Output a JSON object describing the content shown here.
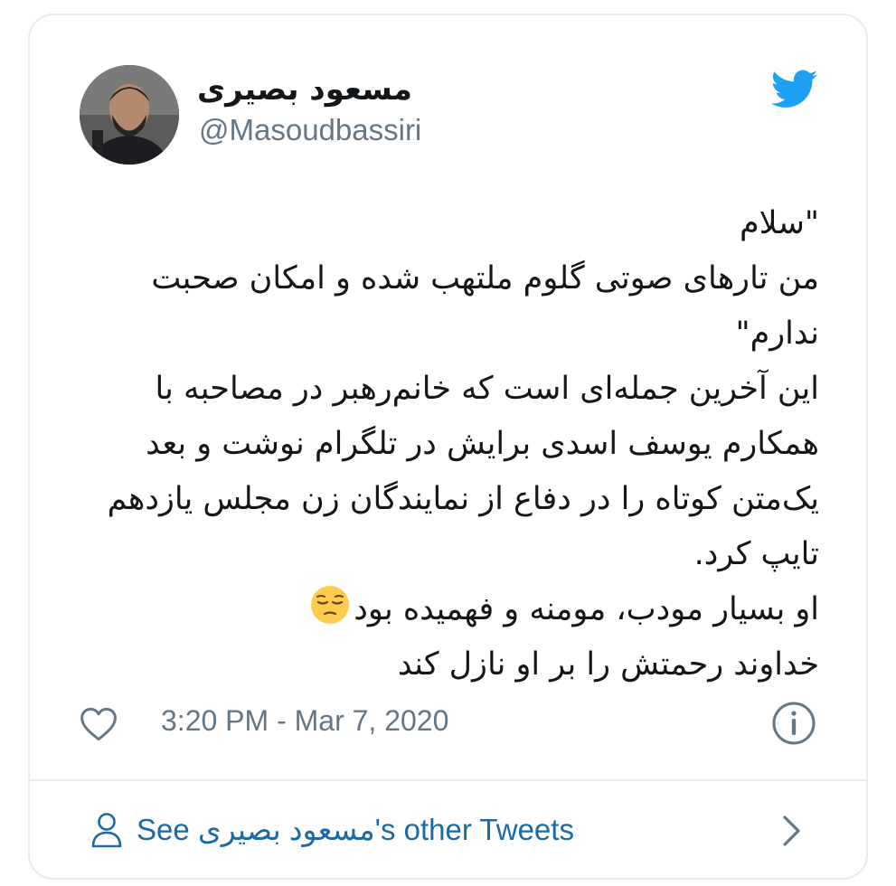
{
  "author": {
    "display_name": "مسعود بصیری",
    "handle": "@Masoudbassiri"
  },
  "tweet": {
    "lines": [
      "\"سلام",
      "من تارهای صوتی گلوم ملتهب شده و امکان صحبت",
      "ندارم\"",
      "این آخرین جمله‌ای است که خانم‌رهبر در مصاحبه با",
      "همکارم یوسف اسدی برایش در تلگرام نوشت و بعد",
      "یک‌متن کوتاه را در دفاع از نمایندگان زن مجلس یازدهم",
      "تایپ کرد.",
      "او بسیار مودب، مومنه و فهمیده بود",
      "خداوند رحمتش را بر او نازل کند"
    ],
    "emoji": "pensive-face"
  },
  "meta": {
    "timestamp": "3:20 PM - Mar 7, 2020"
  },
  "footer": {
    "prefix": "See ",
    "name": "مسعود بصیری",
    "suffix": "'s other Tweets"
  },
  "colors": {
    "twitter_blue": "#1DA1F2",
    "text": "#14171a",
    "secondary": "#657786",
    "link": "#1b6aa5",
    "border": "#e6ecf0"
  }
}
